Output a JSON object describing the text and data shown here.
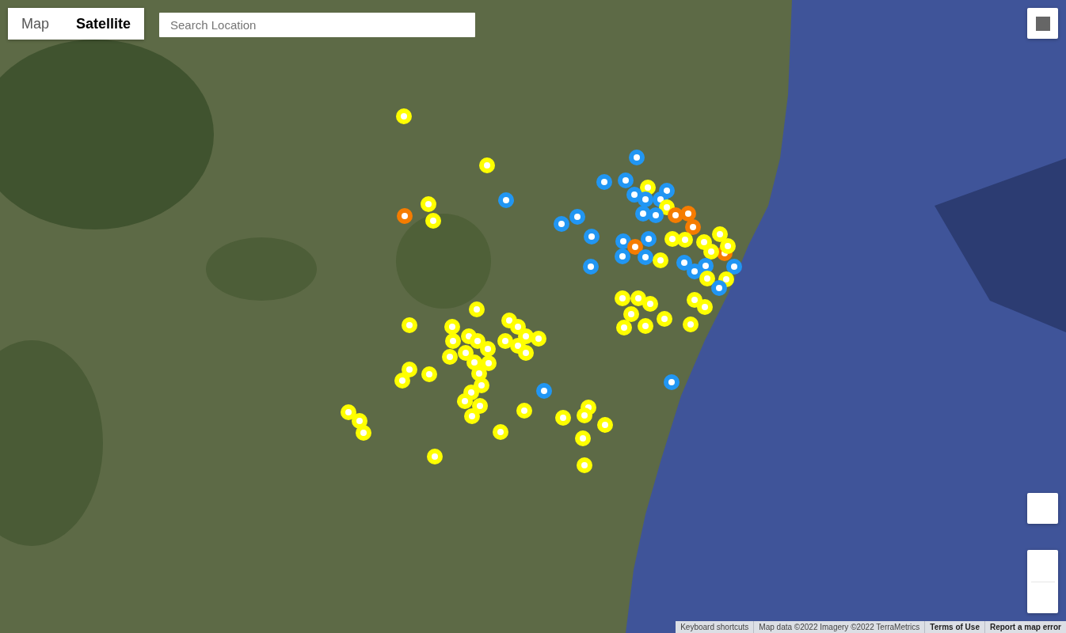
{
  "map_type_control": [
    {
      "label": "Map",
      "selected": false
    },
    {
      "label": "Satellite",
      "selected": true
    }
  ],
  "search": {
    "placeholder": "Search Location"
  },
  "markers": [
    {
      "color": "#ffff00"
    },
    {
      "color": "#2196f3"
    },
    {
      "color": "#ffff00"
    },
    {
      "color": "#2196f3"
    },
    {
      "color": "#2196f3"
    },
    {
      "color": "#ffff00"
    },
    {
      "color": "#2196f3"
    },
    {
      "color": "#2196f3"
    },
    {
      "color": "#2196f3"
    },
    {
      "color": "#2196f3"
    },
    {
      "color": "#2196f3"
    },
    {
      "color": "#ffff00"
    },
    {
      "color": "#ffff00"
    },
    {
      "color": "#2196f3"
    },
    {
      "color": "#2196f3"
    },
    {
      "color": "#f57c00"
    },
    {
      "color": "#f57c00"
    },
    {
      "color": "#f57c00"
    },
    {
      "color": "#2196f3"
    },
    {
      "color": "#ffff00"
    },
    {
      "color": "#2196f3"
    },
    {
      "color": "#f57c00"
    },
    {
      "color": "#ffff00"
    },
    {
      "color": "#2196f3"
    },
    {
      "color": "#ffff00"
    },
    {
      "color": "#2196f3"
    },
    {
      "color": "#ffff00"
    },
    {
      "color": "#2196f3"
    },
    {
      "color": "#ffff00"
    },
    {
      "color": "#f57c00"
    },
    {
      "color": "#ffff00"
    },
    {
      "color": "#f57c00"
    },
    {
      "color": "#ffff00"
    },
    {
      "color": "#2196f3"
    },
    {
      "color": "#2196f3"
    },
    {
      "color": "#ffff00"
    },
    {
      "color": "#2196f3"
    },
    {
      "color": "#2196f3"
    },
    {
      "color": "#2196f3"
    },
    {
      "color": "#2196f3"
    },
    {
      "color": "#2196f3"
    },
    {
      "color": "#ffff00"
    },
    {
      "color": "#ffff00"
    },
    {
      "color": "#2196f3"
    },
    {
      "color": "#ffff00"
    },
    {
      "color": "#ffff00"
    },
    {
      "color": "#ffff00"
    },
    {
      "color": "#ffff00"
    },
    {
      "color": "#ffff00"
    },
    {
      "color": "#ffff00"
    },
    {
      "color": "#ffff00"
    },
    {
      "color": "#ffff00"
    },
    {
      "color": "#ffff00"
    },
    {
      "color": "#ffff00"
    },
    {
      "color": "#ffff00"
    },
    {
      "color": "#ffff00"
    },
    {
      "color": "#ffff00"
    },
    {
      "color": "#ffff00"
    },
    {
      "color": "#ffff00"
    },
    {
      "color": "#ffff00"
    },
    {
      "color": "#ffff00"
    },
    {
      "color": "#ffff00"
    },
    {
      "color": "#ffff00"
    },
    {
      "color": "#ffff00"
    },
    {
      "color": "#ffff00"
    },
    {
      "color": "#ffff00"
    },
    {
      "color": "#ffff00"
    },
    {
      "color": "#ffff00"
    },
    {
      "color": "#ffff00"
    },
    {
      "color": "#ffff00"
    },
    {
      "color": "#ffff00"
    },
    {
      "color": "#ffff00"
    },
    {
      "color": "#ffff00"
    },
    {
      "color": "#ffff00"
    },
    {
      "color": "#ffff00"
    },
    {
      "color": "#ffff00"
    },
    {
      "color": "#2196f3"
    },
    {
      "color": "#ffff00"
    },
    {
      "color": "#2196f3"
    },
    {
      "color": "#ffff00"
    },
    {
      "color": "#ffff00"
    },
    {
      "color": "#ffff00"
    },
    {
      "color": "#ffff00"
    },
    {
      "color": "#ffff00"
    },
    {
      "color": "#ffff00"
    },
    {
      "color": "#ffff00"
    },
    {
      "color": "#ffff00"
    },
    {
      "color": "#ffff00"
    },
    {
      "color": "#ffff00"
    },
    {
      "color": "#ffff00"
    },
    {
      "color": "#ffff00"
    },
    {
      "color": "#ffff00"
    },
    {
      "color": "#ffff00"
    },
    {
      "color": "#ffff00"
    },
    {
      "color": "#ffff00"
    }
  ],
  "attribution": [
    {
      "kind": "button",
      "label": "Keyboard shortcuts"
    },
    {
      "kind": "text",
      "label": "Map data ©2022 Imagery ©2022 TerraMetrics"
    },
    {
      "kind": "link",
      "label": "Terms of Use"
    },
    {
      "kind": "link",
      "label": "Report a map error"
    }
  ]
}
